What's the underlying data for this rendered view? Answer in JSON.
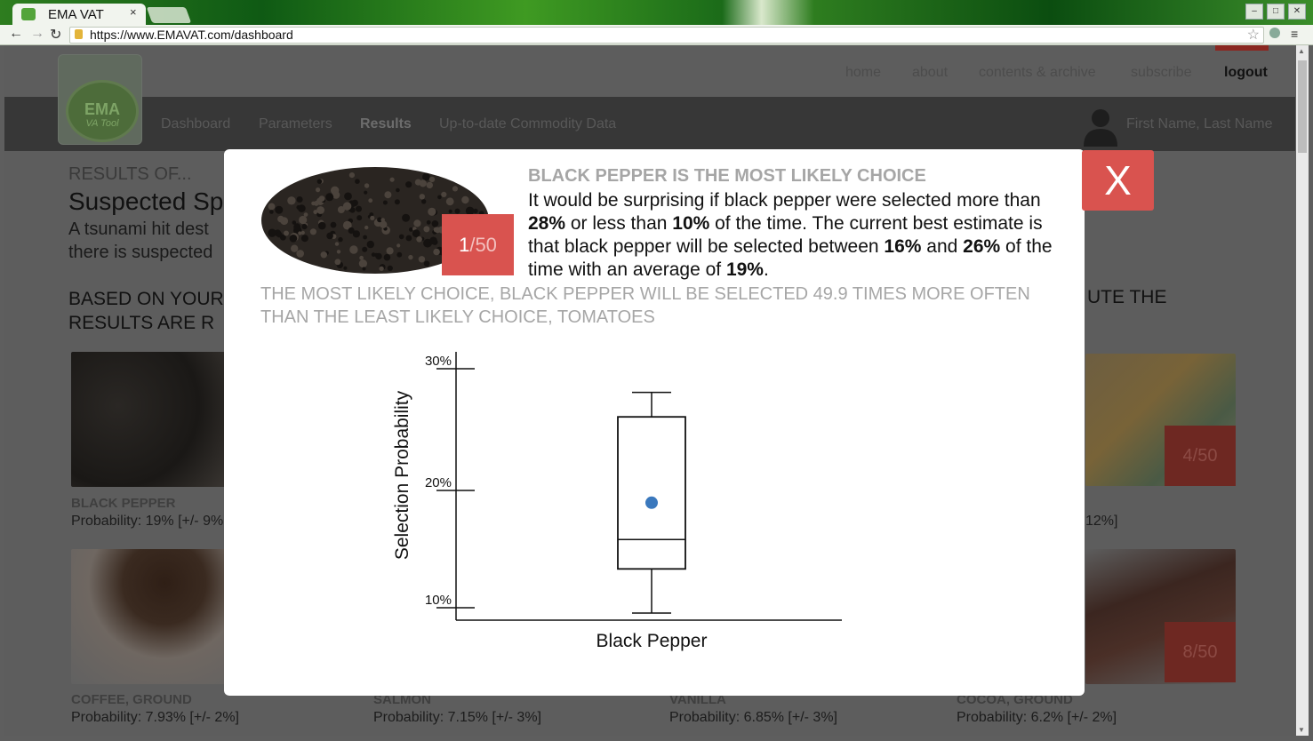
{
  "browser": {
    "tab_title": "EMA VAT",
    "tab_close": "×",
    "url": "https://www.EMAVAT.com/dashboard"
  },
  "site": {
    "logo_text": "EMA",
    "logo_sub": "VA Tool",
    "topnav": [
      "home",
      "about",
      "contents & archive",
      "subscribe",
      "logout"
    ],
    "subnav": [
      "Dashboard",
      "Parameters",
      "Results",
      "Up-to-date Commodity Data"
    ],
    "user_name": "First Name, Last Name"
  },
  "results": {
    "results_of": "RESULTS OF...",
    "scenario_title": "Suspected Sp",
    "description": "A tsunami hit dest there is suspected",
    "based_on_left": "BASED ON YOUR RESULTS ARE R",
    "based_on_right": "UTE THE",
    "cards": [
      {
        "name": "BLACK PEPPER",
        "prob": "Probability: 19% [+/- 9%"
      },
      {
        "name": "",
        "prob": "12%]",
        "badge_num": "4",
        "badge_of": "/50"
      },
      {
        "name": "COFFEE, GROUND",
        "prob": "Probability: 7.93% [+/- 2%]"
      },
      {
        "name": "SALMON",
        "prob": "Probability: 7.15% [+/- 3%]"
      },
      {
        "name": "VANILLA",
        "prob": "Probability: 6.85% [+/- 3%]"
      },
      {
        "name": "COCOA, GROUND",
        "prob": "Probability: 6.2% [+/- 2%]",
        "badge_num": "8",
        "badge_of": "/50"
      }
    ]
  },
  "modal": {
    "close_label": "X",
    "badge_num": "1",
    "badge_of": "/50",
    "heading": "BLACK PEPPER IS THE MOST LIKELY CHOICE",
    "body_parts": [
      "It would be surprising if black pepper were selected more than ",
      "28%",
      " or less than ",
      "10%",
      " of the time. The current best estimate is that black pepper will be selected between ",
      "16%",
      " and ",
      "26%",
      " of the time with an average of ",
      "19%",
      "."
    ],
    "compare": "THE MOST LIKELY CHOICE, BLACK PEPPER WILL BE SELECTED 49.9 TIMES MORE OFTEN THAN THE LEAST LIKELY CHOICE, TOMATOES"
  },
  "chart_data": {
    "type": "boxplot",
    "ylabel": "Selection Probability",
    "xlabel": "Black Pepper",
    "yticks": [
      "30%",
      "20%",
      "10%"
    ],
    "ytick_values": [
      30,
      20,
      10
    ],
    "ylim": [
      9,
      31
    ],
    "categories": [
      "Black Pepper"
    ],
    "box": {
      "whisker_low": 10,
      "q1": 13.6,
      "median": 16,
      "q3": 26,
      "whisker_high": 28,
      "mean": 19
    },
    "mean_color": "#3a78bd"
  },
  "colors": {
    "accent": "#d9534f"
  }
}
